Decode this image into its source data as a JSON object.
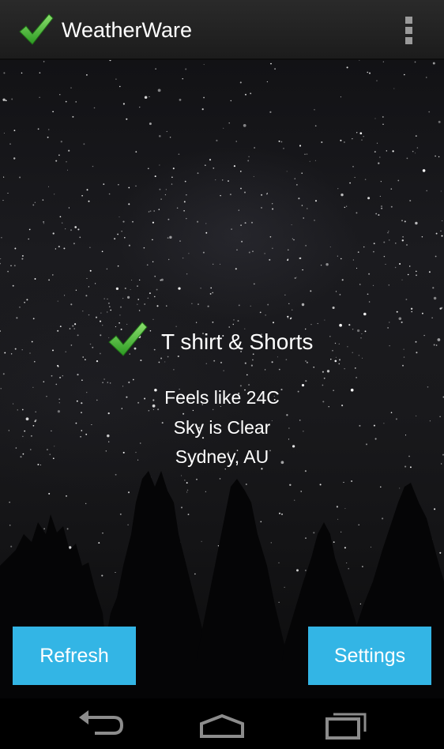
{
  "app": {
    "title": "WeatherWare",
    "icon": "checkmark-icon",
    "overflow_icon": "overflow-menu-icon"
  },
  "recommendation": {
    "icon": "checkmark-icon",
    "outfit": "T shirt & Shorts"
  },
  "weather": {
    "feels_like": "Feels like 24C",
    "sky": "Sky is Clear",
    "location": "Sydney, AU"
  },
  "buttons": {
    "refresh": "Refresh",
    "settings": "Settings"
  },
  "nav": {
    "back_icon": "back-icon",
    "home_icon": "home-icon",
    "recents_icon": "recent-apps-icon"
  },
  "colors": {
    "accent": "#33b5e5",
    "check_green": "#3cae2b",
    "action_bar": "#222222"
  }
}
